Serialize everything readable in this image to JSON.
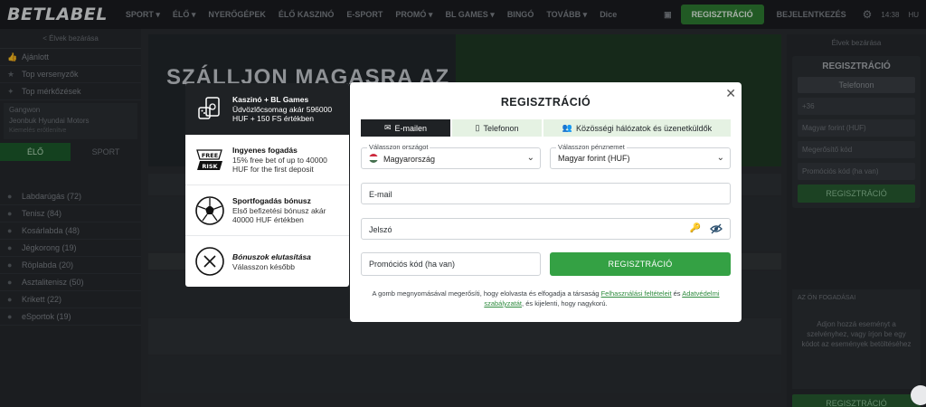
{
  "topbar": {
    "logo": "BETLABEL",
    "nav": [
      "SPORT ▾",
      "ÉLŐ ▾",
      "NYERŐGÉPEK",
      "ÉLŐ KASZINÓ",
      "E-SPORT",
      "PROMÓ ▾",
      "BL GAMES ▾",
      "BINGÓ",
      "TOVÁBB ▾",
      "Dice"
    ],
    "register": "REGISZTRÁCIÓ",
    "login": "BEJELENTKEZÉS",
    "time": "14:38",
    "lang": "HU"
  },
  "left_sidebar": {
    "back": "< Élvek bezárása",
    "rows": [
      "Ajánlott",
      "Top versenyzők",
      "Top mérkőzések",
      "Gangwon",
      "Jeonbuk Hyundai Motors",
      "Kiemelés erőtlenítve"
    ],
    "tabs": [
      "ÉLŐ",
      "SPORT"
    ],
    "sports": [
      "Labdarúgás (72)",
      "Tenisz (84)",
      "Kosárlabda (48)",
      "Jégkorong (19)",
      "Röplabda (20)",
      "Asztalitenisz (50)",
      "Krikett (22)",
      "eSportok (19)"
    ]
  },
  "banner": {
    "headline": "SZÁLLJON MAGASRA AZ"
  },
  "right_sidebar": {
    "back": "Élvek bezárása",
    "title": "REGISZTRÁCIÓ",
    "phone_btn": "Telefonon",
    "currency": "Magyar forint (HUF)",
    "password": "Megerősítő kód",
    "promo": "Promóciós kód (ha van)",
    "register": "REGISZTRÁCIÓ",
    "empty_title": "AZ ÖN FOGADÁSAI",
    "empty_text": "Adjon hozzá eseményt a szelvényhez, vagy írjon be egy kódot az események betöltéséhez",
    "register_bottom": "REGISZTRÁCIÓ"
  },
  "promo_panel": [
    {
      "icon": "casino-chips-icon",
      "title": "Kaszinó + BL Games",
      "text": "Üdvözlőcsomag akár 596000 HUF + 150 FS értékben"
    },
    {
      "icon": "free-risk-icon",
      "title": "Ingyenes fogadás",
      "text": "15% free bet of up to 40000 HUF for the first deposit"
    },
    {
      "icon": "soccer-ball-icon",
      "title": "Sportfogadás bónusz",
      "text": "Első befizetési bónusz akár 40000 HUF értékben"
    },
    {
      "icon": "decline-x-icon",
      "title": "Bónuszok elutasítása",
      "text": "Válasszon később"
    }
  ],
  "modal": {
    "title": "REGISZTRÁCIÓ",
    "tabs": [
      {
        "label": "E-mailen",
        "icon": "envelope-icon"
      },
      {
        "label": "Telefonon",
        "icon": "phone-icon"
      },
      {
        "label": "Közösségi hálózatok és üzenetküldők",
        "icon": "people-icon"
      }
    ],
    "country": {
      "label": "Válasszon országot",
      "value": "Magyarország"
    },
    "currency": {
      "label": "Válasszon pénznemet",
      "value": "Magyar forint (HUF)"
    },
    "email": {
      "placeholder": "E-mail"
    },
    "password": {
      "placeholder": "Jelszó"
    },
    "promo_code": {
      "placeholder": "Promóciós kód (ha van)"
    },
    "submit": "REGISZTRÁCIÓ",
    "disclaimer": {
      "part1": "A gomb megnyomásával megerősíti, hogy elolvasta és elfogadja a társaság ",
      "link1": "Felhasználási feltételeit",
      "part2": " és ",
      "link2": "Adatvédelmi szabályzatát",
      "part3": ", és kijelenti, hogy nagykorú."
    }
  },
  "colors": {
    "accent_green": "#34a144",
    "dark": "#1f2225",
    "tab_bg": "#e5f2e3"
  }
}
